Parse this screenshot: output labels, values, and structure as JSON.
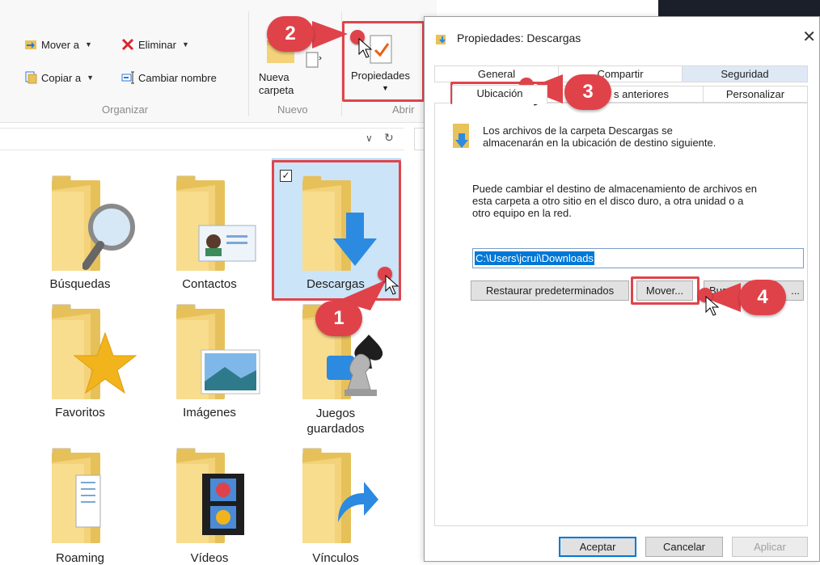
{
  "ribbon": {
    "move_to": "Mover a",
    "copy_to": "Copiar a",
    "delete": "Eliminar",
    "rename": "Cambiar nombre",
    "new_folder_line1": "Nueva",
    "new_folder_line2": "carpeta",
    "properties": "Propiedades",
    "group_organize": "Organizar",
    "group_new": "Nuevo",
    "group_open": "Abrir"
  },
  "folders": [
    {
      "label": "Búsquedas"
    },
    {
      "label": "Contactos"
    },
    {
      "label": "Descargas"
    },
    {
      "label": "Favoritos"
    },
    {
      "label": "Imágenes"
    },
    {
      "label_line1": "Juegos",
      "label_line2": "guardados"
    },
    {
      "label": "Roaming"
    },
    {
      "label": "Vídeos"
    },
    {
      "label": "Vínculos"
    }
  ],
  "dialog": {
    "title": "Propiedades: Descargas",
    "tabs_row1": [
      "General",
      "Compartir",
      "Seguridad"
    ],
    "tabs_row2": [
      "Ubicación",
      "s anteriores",
      "Personalizar"
    ],
    "info_line1": "Los archivos de la carpeta Descargas se",
    "info_line2": "almacenarán en la ubicación de destino siguiente.",
    "desc_line1": "Puede cambiar el destino de almacenamiento de archivos en",
    "desc_line2": "esta carpeta a otro sitio en el disco duro, a otra unidad o a",
    "desc_line3": "otro equipo en la red.",
    "path_value": "C:\\Users\\jcrui\\Downloads",
    "restore_button": "Restaurar predeterminados",
    "move_button": "Mover...",
    "search_button_left": "Bus",
    "search_button_right": "...",
    "ok_button": "Aceptar",
    "cancel_button": "Cancelar",
    "apply_button": "Aplicar"
  },
  "steps": {
    "step1": "1",
    "step2": "2",
    "step3": "3",
    "step4": "4"
  },
  "colors": {
    "marker_red": "#e0424a",
    "selection_blue": "#cce4f7",
    "accent_blue": "#0078d7"
  }
}
